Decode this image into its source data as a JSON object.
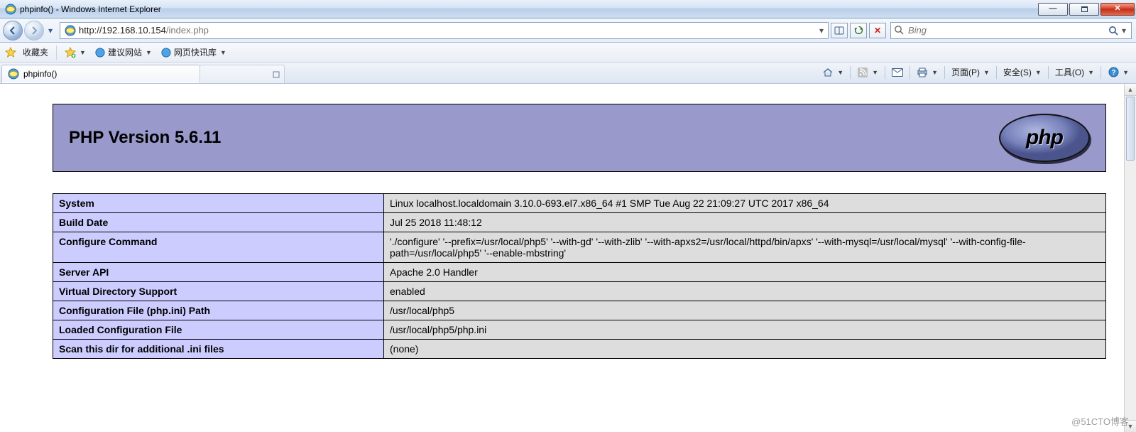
{
  "window": {
    "title": "phpinfo() - Windows Internet Explorer"
  },
  "address": {
    "scheme": "http://",
    "host": "192.168.10.154",
    "path": "/index.php"
  },
  "search": {
    "placeholder": "Bing"
  },
  "favbar": {
    "label": "收藏夹",
    "suggested": "建议网站",
    "express": "网页快讯库"
  },
  "tab": {
    "title": "phpinfo()"
  },
  "cmdrow": {
    "page": "页面(P)",
    "safety": "安全(S)",
    "tools": "工具(O)"
  },
  "php": {
    "title": "PHP Version 5.6.11",
    "logo_text": "php",
    "rows": [
      {
        "k": "System",
        "v": "Linux localhost.localdomain 3.10.0-693.el7.x86_64 #1 SMP Tue Aug 22 21:09:27 UTC 2017 x86_64"
      },
      {
        "k": "Build Date",
        "v": "Jul 25 2018 11:48:12"
      },
      {
        "k": "Configure Command",
        "v": "'./configure' '--prefix=/usr/local/php5' '--with-gd' '--with-zlib' '--with-apxs2=/usr/local/httpd/bin/apxs' '--with-mysql=/usr/local/mysql' '--with-config-file-path=/usr/local/php5' '--enable-mbstring'"
      },
      {
        "k": "Server API",
        "v": "Apache 2.0 Handler"
      },
      {
        "k": "Virtual Directory Support",
        "v": "enabled"
      },
      {
        "k": "Configuration File (php.ini) Path",
        "v": "/usr/local/php5"
      },
      {
        "k": "Loaded Configuration File",
        "v": "/usr/local/php5/php.ini"
      },
      {
        "k": "Scan this dir for additional .ini files",
        "v": "(none)"
      }
    ]
  },
  "watermark": "@51CTO博客"
}
